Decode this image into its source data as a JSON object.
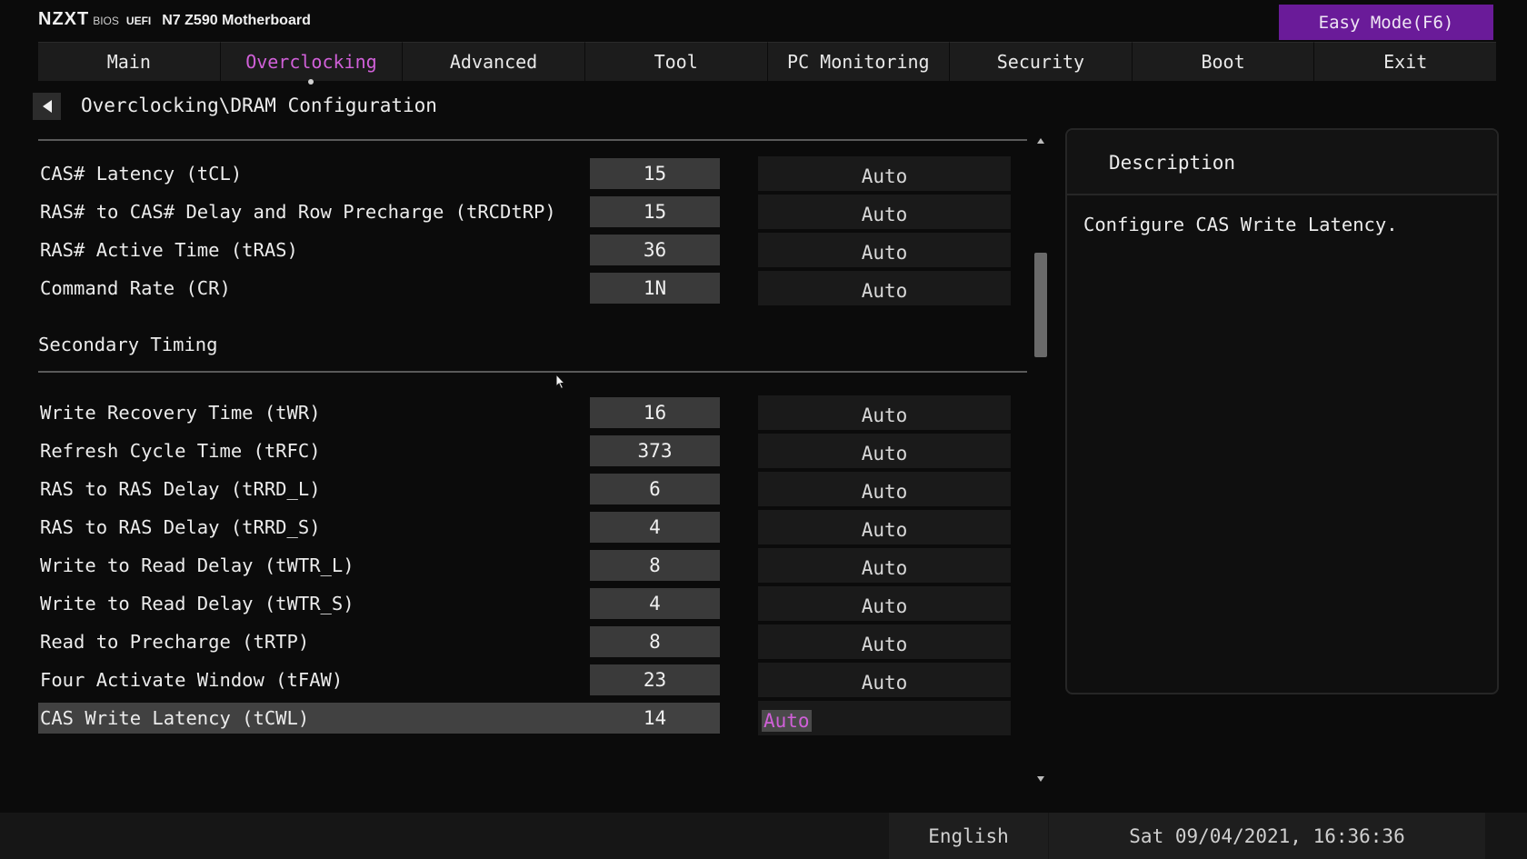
{
  "brand": {
    "logo": "NZXT",
    "bios": "BIOS",
    "uefi": "UEFI",
    "model": "N7 Z590 Motherboard"
  },
  "easy_mode_label": "Easy Mode(F6)",
  "tabs": [
    {
      "label": "Main"
    },
    {
      "label": "Overclocking",
      "active": true
    },
    {
      "label": "Advanced"
    },
    {
      "label": "Tool"
    },
    {
      "label": "PC Monitoring"
    },
    {
      "label": "Security"
    },
    {
      "label": "Boot"
    },
    {
      "label": "Exit"
    }
  ],
  "breadcrumb": "Overclocking\\DRAM Configuration",
  "primary_rows": [
    {
      "label": "CAS# Latency (tCL)",
      "value": "15",
      "mode": "Auto"
    },
    {
      "label": "RAS# to CAS# Delay and Row Precharge (tRCDtRP)",
      "value": "15",
      "mode": "Auto"
    },
    {
      "label": "RAS# Active Time (tRAS)",
      "value": "36",
      "mode": "Auto"
    },
    {
      "label": "Command Rate (CR)",
      "value": "1N",
      "mode": "Auto"
    }
  ],
  "secondary_title": "Secondary Timing",
  "secondary_rows": [
    {
      "label": "Write Recovery Time (tWR)",
      "value": "16",
      "mode": "Auto"
    },
    {
      "label": "Refresh Cycle Time (tRFC)",
      "value": "373",
      "mode": "Auto"
    },
    {
      "label": "RAS to RAS Delay (tRRD_L)",
      "value": "6",
      "mode": "Auto"
    },
    {
      "label": "RAS to RAS Delay (tRRD_S)",
      "value": "4",
      "mode": "Auto"
    },
    {
      "label": "Write to Read Delay (tWTR_L)",
      "value": "8",
      "mode": "Auto"
    },
    {
      "label": "Write to Read Delay (tWTR_S)",
      "value": "4",
      "mode": "Auto"
    },
    {
      "label": "Read to Precharge (tRTP)",
      "value": "8",
      "mode": "Auto"
    },
    {
      "label": "Four Activate Window (tFAW)",
      "value": "23",
      "mode": "Auto"
    },
    {
      "label": "CAS Write Latency (tCWL)",
      "value": "14",
      "mode": "Auto",
      "selected": true
    }
  ],
  "description": {
    "title": "Description",
    "text": "Configure CAS Write Latency."
  },
  "footer": {
    "language": "English",
    "datetime": "Sat 09/04/2021, 16:36:36"
  },
  "colors": {
    "accent": "#6a1b99",
    "active_text": "#d060d8",
    "background": "#0b0b0b"
  }
}
